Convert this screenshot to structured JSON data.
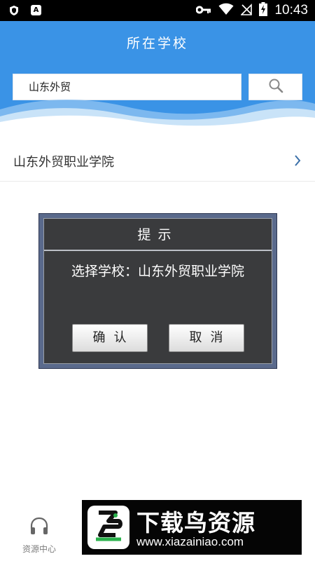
{
  "status_bar": {
    "time": "10:43",
    "badge_a": "A"
  },
  "header": {
    "title": "所在学校",
    "search_value": "山东外贸"
  },
  "results": [
    {
      "name": "山东外贸职业学院"
    }
  ],
  "dialog": {
    "title": "提示",
    "message": "选择学校：山东外贸职业学院",
    "confirm_label": "确认",
    "cancel_label": "取消"
  },
  "bottom_nav": {
    "resource_center_label": "资源中心"
  },
  "watermark": {
    "title": "下载鸟资源",
    "url": "www.xiazainiao.com"
  },
  "colors": {
    "header_blue": "#3a93e6",
    "dialog_bg": "#3a3b3d"
  }
}
